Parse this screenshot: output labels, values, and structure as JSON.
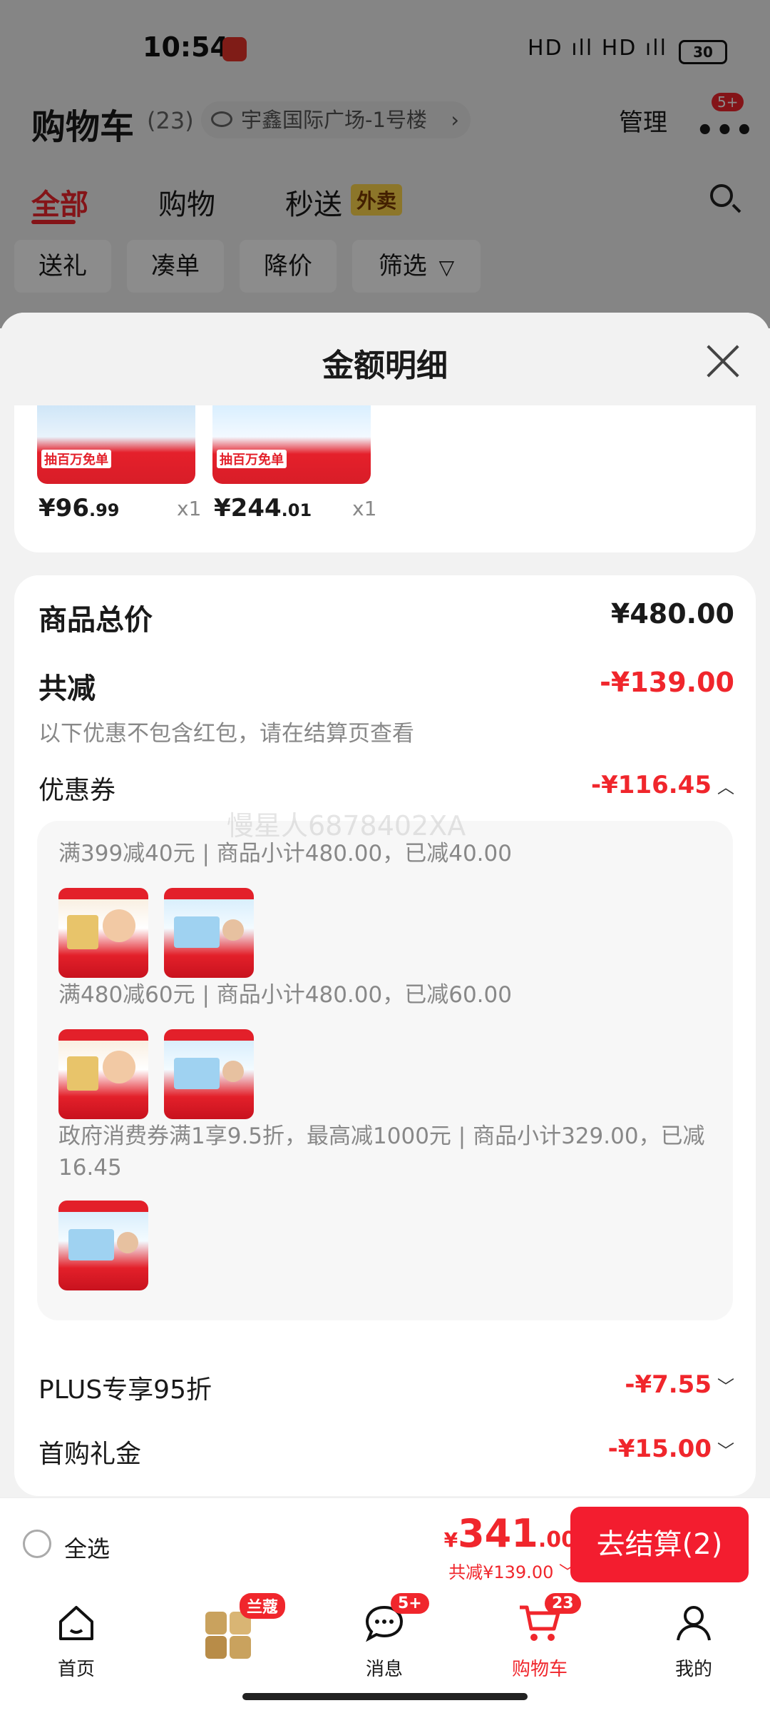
{
  "status": {
    "time": "10:54",
    "signal": "HD ıll HD ıll",
    "battery": "30"
  },
  "header": {
    "title": "购物车",
    "count": "(23)",
    "address": "宇鑫国际广场-1号楼",
    "address_chevron": "›",
    "manage": "管理",
    "more": "•••",
    "more_badge": "5+"
  },
  "tabs": [
    {
      "label": "全部",
      "active": true
    },
    {
      "label": "购物"
    },
    {
      "label": "秒送"
    }
  ],
  "waimai_tag": "外卖",
  "filters": [
    "送礼",
    "凑单",
    "降价",
    "筛选"
  ],
  "sheet": {
    "title": "金额明细",
    "items": [
      {
        "price_int": "¥96",
        "price_dec": ".99",
        "qty": "x1",
        "badge": "抽百万免单"
      },
      {
        "price_int": "¥244",
        "price_dec": ".01",
        "qty": "x1",
        "badge": "抽百万免单"
      }
    ],
    "total_label": "商品总价",
    "total_value": "¥480.00",
    "discount_label": "共减",
    "discount_value": "-¥139.00",
    "discount_note": "以下优惠不包含红包，请在结算页查看",
    "coupon_label": "优惠券",
    "coupon_value": "-¥116.45",
    "coupons": [
      {
        "text": "满399减40元 | 商品小计480.00，已减40.00"
      },
      {
        "text": "满480减60元 | 商品小计480.00，已减60.00"
      },
      {
        "text": "政府消费券满1享9.5折，最高减1000元 | 商品小计329.00，已减16.45"
      }
    ],
    "plus_label": "PLUS专享95折",
    "plus_value": "-¥7.55",
    "first_label": "首购礼金",
    "first_value": "-¥15.00",
    "watermark": "慢星人6878402XA"
  },
  "checkout": {
    "select_all": "全选",
    "yen": "¥",
    "amount_int": "341",
    "amount_dec": ".00",
    "saved": "共减¥139.00",
    "pay_button": "去结算(2)"
  },
  "tabbar": [
    {
      "label": "首页"
    },
    {
      "label": "",
      "badge": "兰蔻"
    },
    {
      "label": "消息",
      "badge": "5+"
    },
    {
      "label": "购物车",
      "badge": "23",
      "active": true
    },
    {
      "label": "我的"
    }
  ],
  "colors": {
    "accent": "#f0262c",
    "pay": "#f31d2f"
  }
}
